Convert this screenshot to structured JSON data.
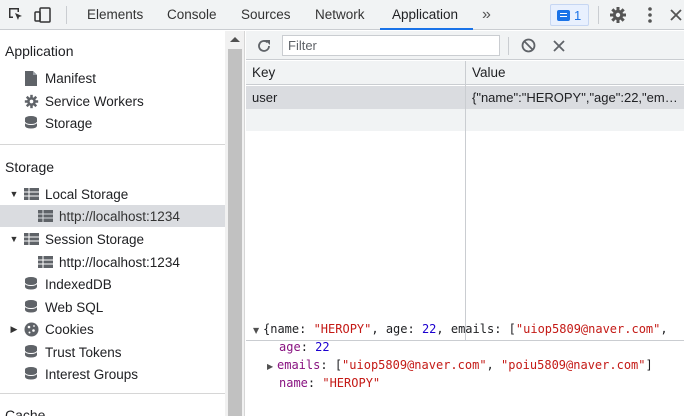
{
  "toolbar": {
    "tabs": [
      {
        "label": "Elements"
      },
      {
        "label": "Console"
      },
      {
        "label": "Sources"
      },
      {
        "label": "Network"
      },
      {
        "label": "Application"
      }
    ],
    "more_label": "»",
    "issues_count": "1",
    "accent_color": "#1a73e8"
  },
  "sidebar": {
    "application_heading": "Application",
    "application_items": [
      {
        "label": "Manifest",
        "icon": "file-icon"
      },
      {
        "label": "Service Workers",
        "icon": "gear-icon"
      },
      {
        "label": "Storage",
        "icon": "database-icon"
      }
    ],
    "storage_heading": "Storage",
    "storage_items": [
      {
        "label": "Local Storage",
        "icon": "grid-icon",
        "expanded": true
      },
      {
        "label": "http://localhost:1234",
        "icon": "grid-icon",
        "selected": true
      },
      {
        "label": "Session Storage",
        "icon": "grid-icon",
        "expanded": true
      },
      {
        "label": "http://localhost:1234",
        "icon": "grid-icon"
      },
      {
        "label": "IndexedDB",
        "icon": "database-icon"
      },
      {
        "label": "Web SQL",
        "icon": "database-icon"
      },
      {
        "label": "Cookies",
        "icon": "cookie-icon",
        "expanded": false
      },
      {
        "label": "Trust Tokens",
        "icon": "database-icon"
      },
      {
        "label": "Interest Groups",
        "icon": "database-icon"
      }
    ],
    "cache_heading": "Cache"
  },
  "main": {
    "filter_placeholder": "Filter",
    "columns": {
      "key": "Key",
      "value": "Value"
    },
    "rows": [
      {
        "key": "user",
        "value": "{\"name\":\"HEROPY\",\"age\":22,\"ema…"
      }
    ]
  },
  "preview": {
    "summary_prefix": "{name: ",
    "summary_name": "\"HEROPY\"",
    "summary_mid": ", age: ",
    "summary_age": "22",
    "summary_mid2": ", emails: [",
    "summary_email": "\"uiop5809@naver.com\"",
    "summary_tail": ",",
    "age_key": "age",
    "age_value": "22",
    "emails_key": "emails",
    "emails_open": "[",
    "email_1": "\"uiop5809@naver.com\"",
    "email_sep": ", ",
    "email_2": "\"poiu5809@naver.com\"",
    "emails_close": "]",
    "name_key": "name",
    "name_value": "\"HEROPY\""
  }
}
